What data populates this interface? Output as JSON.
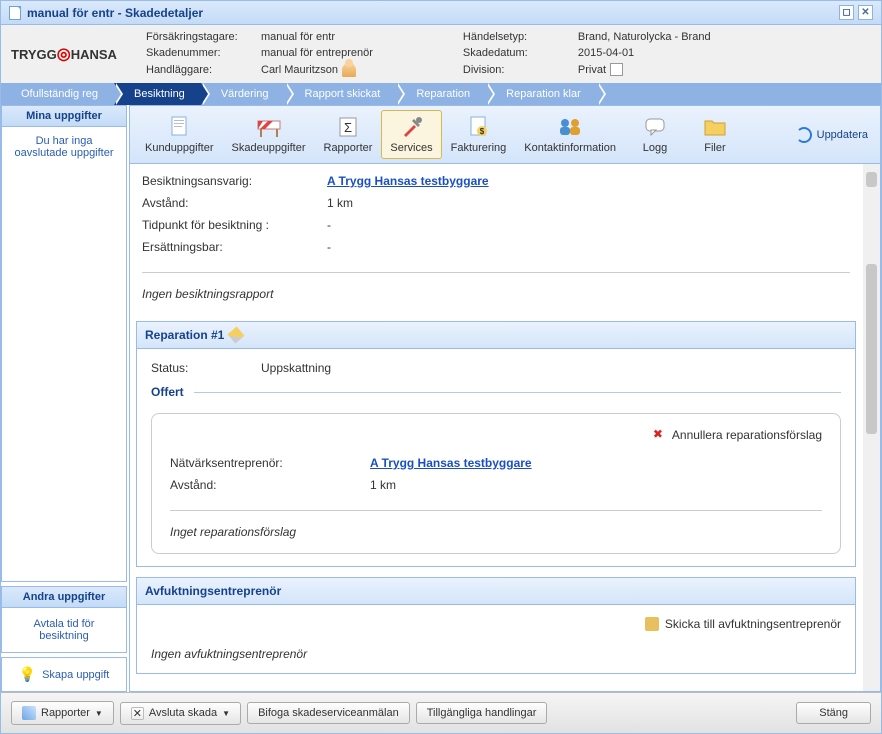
{
  "window": {
    "title": "manual för entr - Skadedetaljer",
    "maximize": "◻",
    "close": "✕"
  },
  "logo": {
    "t1": "TRYGG",
    "t2": "HANSA"
  },
  "info": {
    "l1": "Försäkringstagare:",
    "v1": "manual för entr",
    "l2": "Skadenummer:",
    "v2": "manual för entreprenör",
    "l3": "Handläggare:",
    "v3": "Carl Mauritzson",
    "r1": "Händelsetyp:",
    "rv1": "Brand, Naturolycka - Brand",
    "r2": "Skadedatum:",
    "rv2": "2015-04-01",
    "r3": "Division:",
    "rv3": "Privat"
  },
  "prog": [
    "Ofullständig reg",
    "Besiktning",
    "Värdering",
    "Rapport skickat",
    "Reparation",
    "Reparation klar"
  ],
  "sidebar": {
    "p1_head": "Mina uppgifter",
    "p1_body": "Du har inga oavslutade uppgifter",
    "p2_head": "Andra uppgifter",
    "p2_link": "Avtala tid för besiktning",
    "btn": "Skapa uppgift"
  },
  "toolbar": {
    "b1": "Kunduppgifter",
    "b2": "Skadeuppgifter",
    "b3": "Rapporter",
    "b4": "Services",
    "b5": "Fakturering",
    "b6": "Kontaktinformation",
    "b7": "Logg",
    "b8": "Filer",
    "refresh": "Uppdatera"
  },
  "content": {
    "r1l": "Besiktningsansvarig:",
    "r1v": "A Trygg Hansas testbyggare",
    "r2l": "Avstånd:",
    "r2v": "1 km",
    "r3l": "Tidpunkt för besiktning :",
    "r3v": "-",
    "r4l": "Ersättningsbar:",
    "r4v": "-",
    "note1": "Ingen besiktningsrapport",
    "sec2_title": "Reparation #1",
    "s1l": "Status:",
    "s1v": "Uppskattning",
    "offert": "Offert",
    "annul": "Annullera reparationsförslag",
    "n1l": "Nätvärksentreprenör:",
    "n1v": "A Trygg Hansas testbyggare",
    "n2l": "Avstånd:",
    "n2v": "1 km",
    "note2": "Inget reparationsförslag",
    "sec3_title": "Avfuktningsentreprenör",
    "send": "Skicka till avfuktningsentreprenör",
    "note3": "Ingen avfuktningsentreprenör"
  },
  "bottom": {
    "b1": "Rapporter",
    "b2": "Avsluta skada",
    "b3": "Bifoga skadeserviceanmälan",
    "b4": "Tillgängliga handlingar",
    "close": "Stäng"
  }
}
